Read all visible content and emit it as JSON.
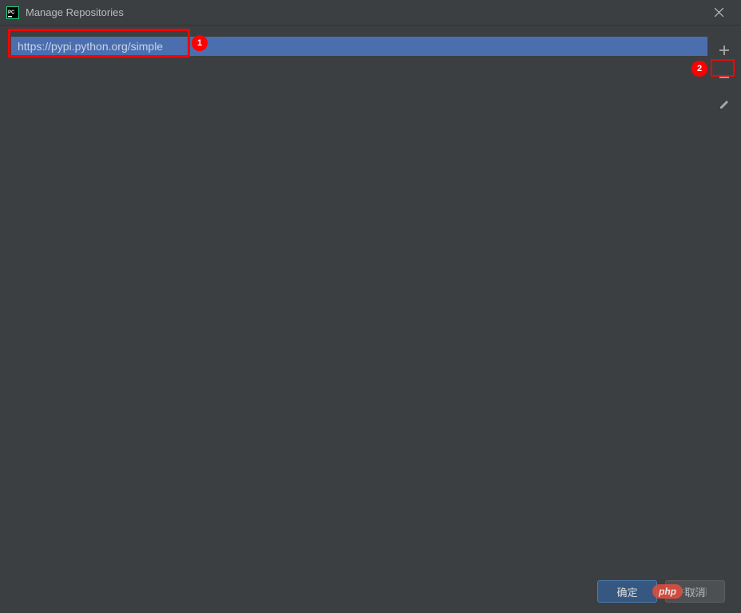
{
  "window": {
    "title": "Manage Repositories"
  },
  "repositories": {
    "items": [
      "https://pypi.python.org/simple"
    ]
  },
  "toolbar": {
    "add_tooltip": "Add",
    "remove_tooltip": "Remove",
    "edit_tooltip": "Edit"
  },
  "buttons": {
    "ok_label": "确定",
    "cancel_label": "取消"
  },
  "annotations": {
    "badge1": "1",
    "badge2": "2"
  },
  "watermark": {
    "text": "php",
    "tail": "中文网"
  }
}
